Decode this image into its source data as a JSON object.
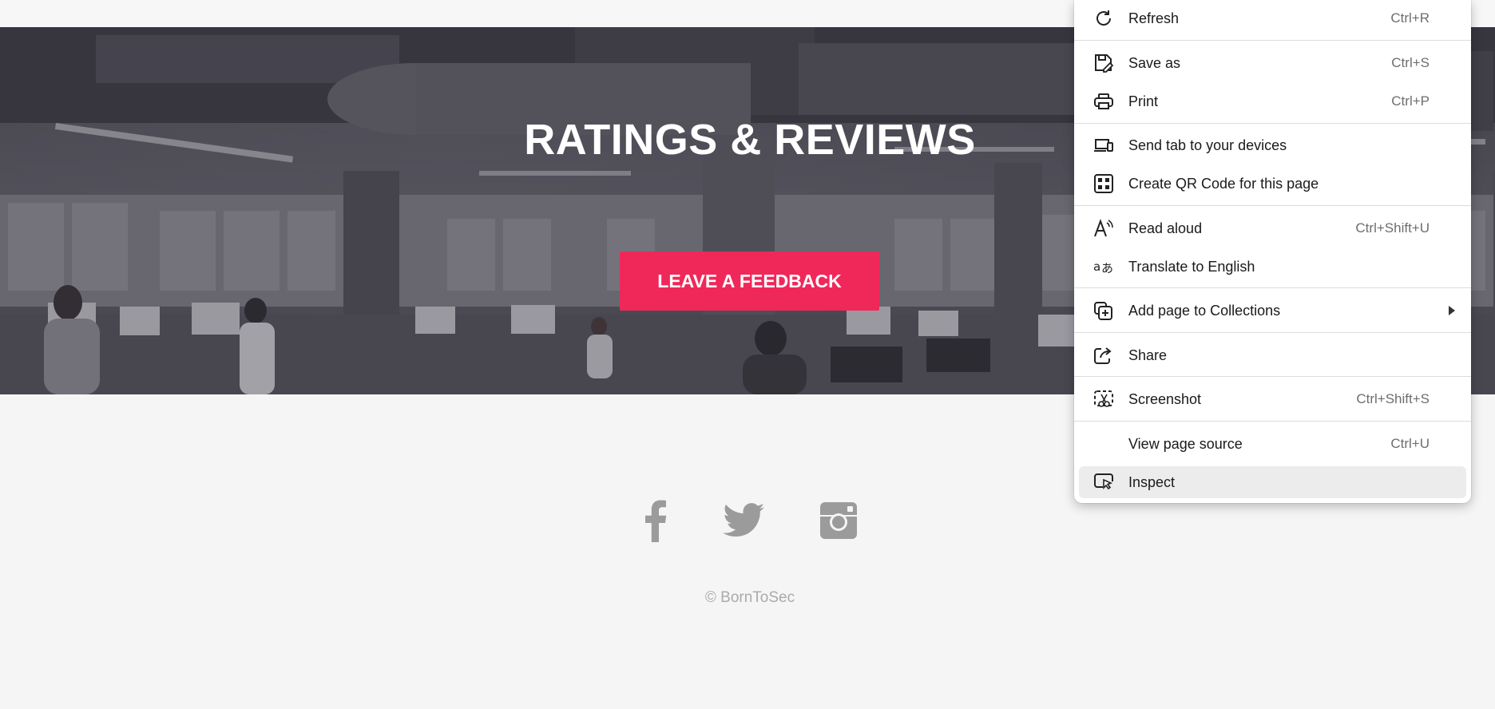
{
  "hero": {
    "title": "RATINGS & REVIEWS",
    "button_label": "LEAVE A FEEDBACK",
    "button_color": "#f0285a"
  },
  "footer": {
    "social_icons": [
      "facebook-icon",
      "twitter-icon",
      "instagram-icon"
    ],
    "copyright": "© BornToSec"
  },
  "context_menu": {
    "items": [
      {
        "id": "refresh",
        "icon": "refresh-icon",
        "label": "Refresh",
        "shortcut": "Ctrl+R"
      },
      {
        "id": "save-as",
        "icon": "save-icon",
        "label": "Save as",
        "shortcut": "Ctrl+S"
      },
      {
        "id": "print",
        "icon": "print-icon",
        "label": "Print",
        "shortcut": "Ctrl+P"
      },
      {
        "id": "send-tab",
        "icon": "devices-icon",
        "label": "Send tab to your devices",
        "shortcut": ""
      },
      {
        "id": "qr-code",
        "icon": "qr-code-icon",
        "label": "Create QR Code for this page",
        "shortcut": ""
      },
      {
        "id": "read-aloud",
        "icon": "read-aloud-icon",
        "label": "Read aloud",
        "shortcut": "Ctrl+Shift+U"
      },
      {
        "id": "translate",
        "icon": "translate-icon",
        "label": "Translate to English",
        "shortcut": ""
      },
      {
        "id": "collections",
        "icon": "collections-icon",
        "label": "Add page to Collections",
        "shortcut": "",
        "submenu": true
      },
      {
        "id": "share",
        "icon": "share-icon",
        "label": "Share",
        "shortcut": ""
      },
      {
        "id": "screenshot",
        "icon": "screenshot-icon",
        "label": "Screenshot",
        "shortcut": "Ctrl+Shift+S"
      },
      {
        "id": "view-source",
        "icon": "",
        "label": "View page source",
        "shortcut": "Ctrl+U"
      },
      {
        "id": "inspect",
        "icon": "inspect-icon",
        "label": "Inspect",
        "shortcut": "",
        "highlighted": true
      }
    ]
  }
}
